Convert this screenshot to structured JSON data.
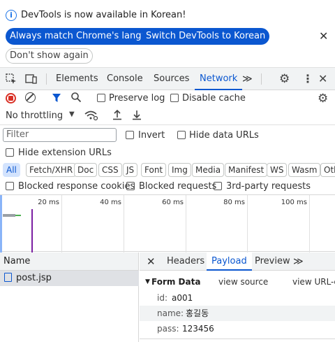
{
  "infobar": {
    "message": "DevTools is now available in Korean!",
    "btn_match": "Always match Chrome's language",
    "btn_switch": "Switch DevTools to Korean",
    "btn_dont_show": "Don't show again"
  },
  "tabs": {
    "elements": "Elements",
    "console": "Console",
    "sources": "Sources",
    "network": "Network",
    "more": "≫"
  },
  "toolbar": {
    "preserve_log": "Preserve log",
    "disable_cache": "Disable cache",
    "throttling": "No throttling"
  },
  "filter": {
    "placeholder": "Filter",
    "invert": "Invert",
    "hide_data_urls": "Hide data URLs",
    "hide_extension_urls": "Hide extension URLs"
  },
  "type_chips": [
    "All",
    "Fetch/XHR",
    "Doc",
    "CSS",
    "JS",
    "Font",
    "Img",
    "Media",
    "Manifest",
    "WS",
    "Wasm",
    "Oth"
  ],
  "blocked": {
    "response_cookies": "Blocked response cookies",
    "requests": "Blocked requests",
    "third_party": "3rd-party requests"
  },
  "timeline": {
    "ticks": [
      "20 ms",
      "40 ms",
      "60 ms",
      "80 ms",
      "100 ms"
    ]
  },
  "requests": {
    "header_name": "Name",
    "items": [
      "post.jsp"
    ]
  },
  "details": {
    "tabs": {
      "headers": "Headers",
      "payload": "Payload",
      "preview": "Preview",
      "more": "≫"
    },
    "form_data_title": "Form Data",
    "view_source": "view source",
    "view_url_encoded": "view URL-e",
    "fields": [
      {
        "key": "id:",
        "value": "a001"
      },
      {
        "key": "name:",
        "value": "홍길동"
      },
      {
        "key": "pass:",
        "value": "123456"
      }
    ]
  },
  "colors": {
    "accent": "#0b57d0",
    "record_red": "#d93025",
    "chip_selected_bg": "#d3e3fd"
  }
}
